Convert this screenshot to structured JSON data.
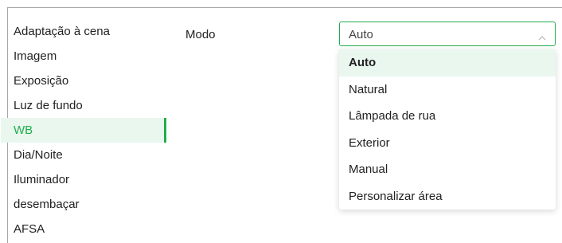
{
  "sidebar": {
    "items": [
      {
        "label": "Adaptação à cena"
      },
      {
        "label": "Imagem"
      },
      {
        "label": "Exposição"
      },
      {
        "label": "Luz de fundo"
      },
      {
        "label": "WB",
        "active": true
      },
      {
        "label": "Dia/Noite"
      },
      {
        "label": "Iluminador"
      },
      {
        "label": "desembaçar"
      },
      {
        "label": "AFSA"
      }
    ]
  },
  "mode": {
    "label": "Modo",
    "selected_value": "Auto",
    "chevron_icon": "chevron-up-icon",
    "options": [
      "Auto",
      "Natural",
      "Lâmpada de rua",
      "Exterior",
      "Manual",
      "Personalizar área"
    ],
    "selected_index": 0
  },
  "colors": {
    "accent": "#1fae4c",
    "highlight_bg": "#e9f7ef",
    "text": "#222222"
  }
}
